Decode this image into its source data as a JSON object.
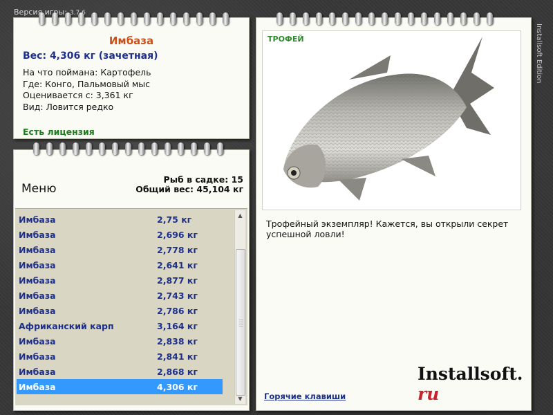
{
  "version": {
    "label": "Версия игры:",
    "number": "3.7.6"
  },
  "catch_info": {
    "fish_name": "Имбаза",
    "weight": "Вес: 4,306 кг (зачетная)",
    "bait": "На что поймана: Картофель",
    "place": "Где: Конго, Пальмовый мыс",
    "rated_from": "Оценивается с: 3,361 кг",
    "rarity": "Вид: Ловится редко",
    "license": "Есть лицензия"
  },
  "menu": {
    "title": "Меню",
    "fish_count": "Рыб в садке: 15",
    "total_weight": "Общий вес: 45,104 кг",
    "items": [
      {
        "name": "Имбаза",
        "weight": "2,75 кг"
      },
      {
        "name": "Имбаза",
        "weight": "2,696 кг"
      },
      {
        "name": "Имбаза",
        "weight": "2,778 кг"
      },
      {
        "name": "Имбаза",
        "weight": "2,641 кг"
      },
      {
        "name": "Имбаза",
        "weight": "2,877 кг"
      },
      {
        "name": "Имбаза",
        "weight": "2,743 кг"
      },
      {
        "name": "Имбаза",
        "weight": "2,786 кг"
      },
      {
        "name": "Африканский карп",
        "weight": "3,164 кг"
      },
      {
        "name": "Имбаза",
        "weight": "2,838 кг"
      },
      {
        "name": "Имбаза",
        "weight": "2,841 кг"
      },
      {
        "name": "Имбаза",
        "weight": "2,868 кг"
      },
      {
        "name": "Имбаза",
        "weight": "4,306 кг"
      }
    ],
    "selected_index": 11
  },
  "trophy": {
    "label": "ТРОФЕЙ",
    "description": "Трофейный экземпляр! Кажется, вы открыли секрет успешной ловли!",
    "hotkeys": "Горячие клавиши"
  },
  "logo": {
    "main": "Installsoft.",
    "suffix": "ru"
  },
  "side_text": "Installsoft Edition",
  "colors": {
    "fish_name": "#c8501a",
    "accent_blue": "#1d2f8c",
    "license_green": "#1e7d1e",
    "selection": "#3399ff"
  },
  "icons": [
    "ring-binder-icon",
    "scroll-up-icon",
    "scroll-down-icon",
    "fish-photo"
  ]
}
